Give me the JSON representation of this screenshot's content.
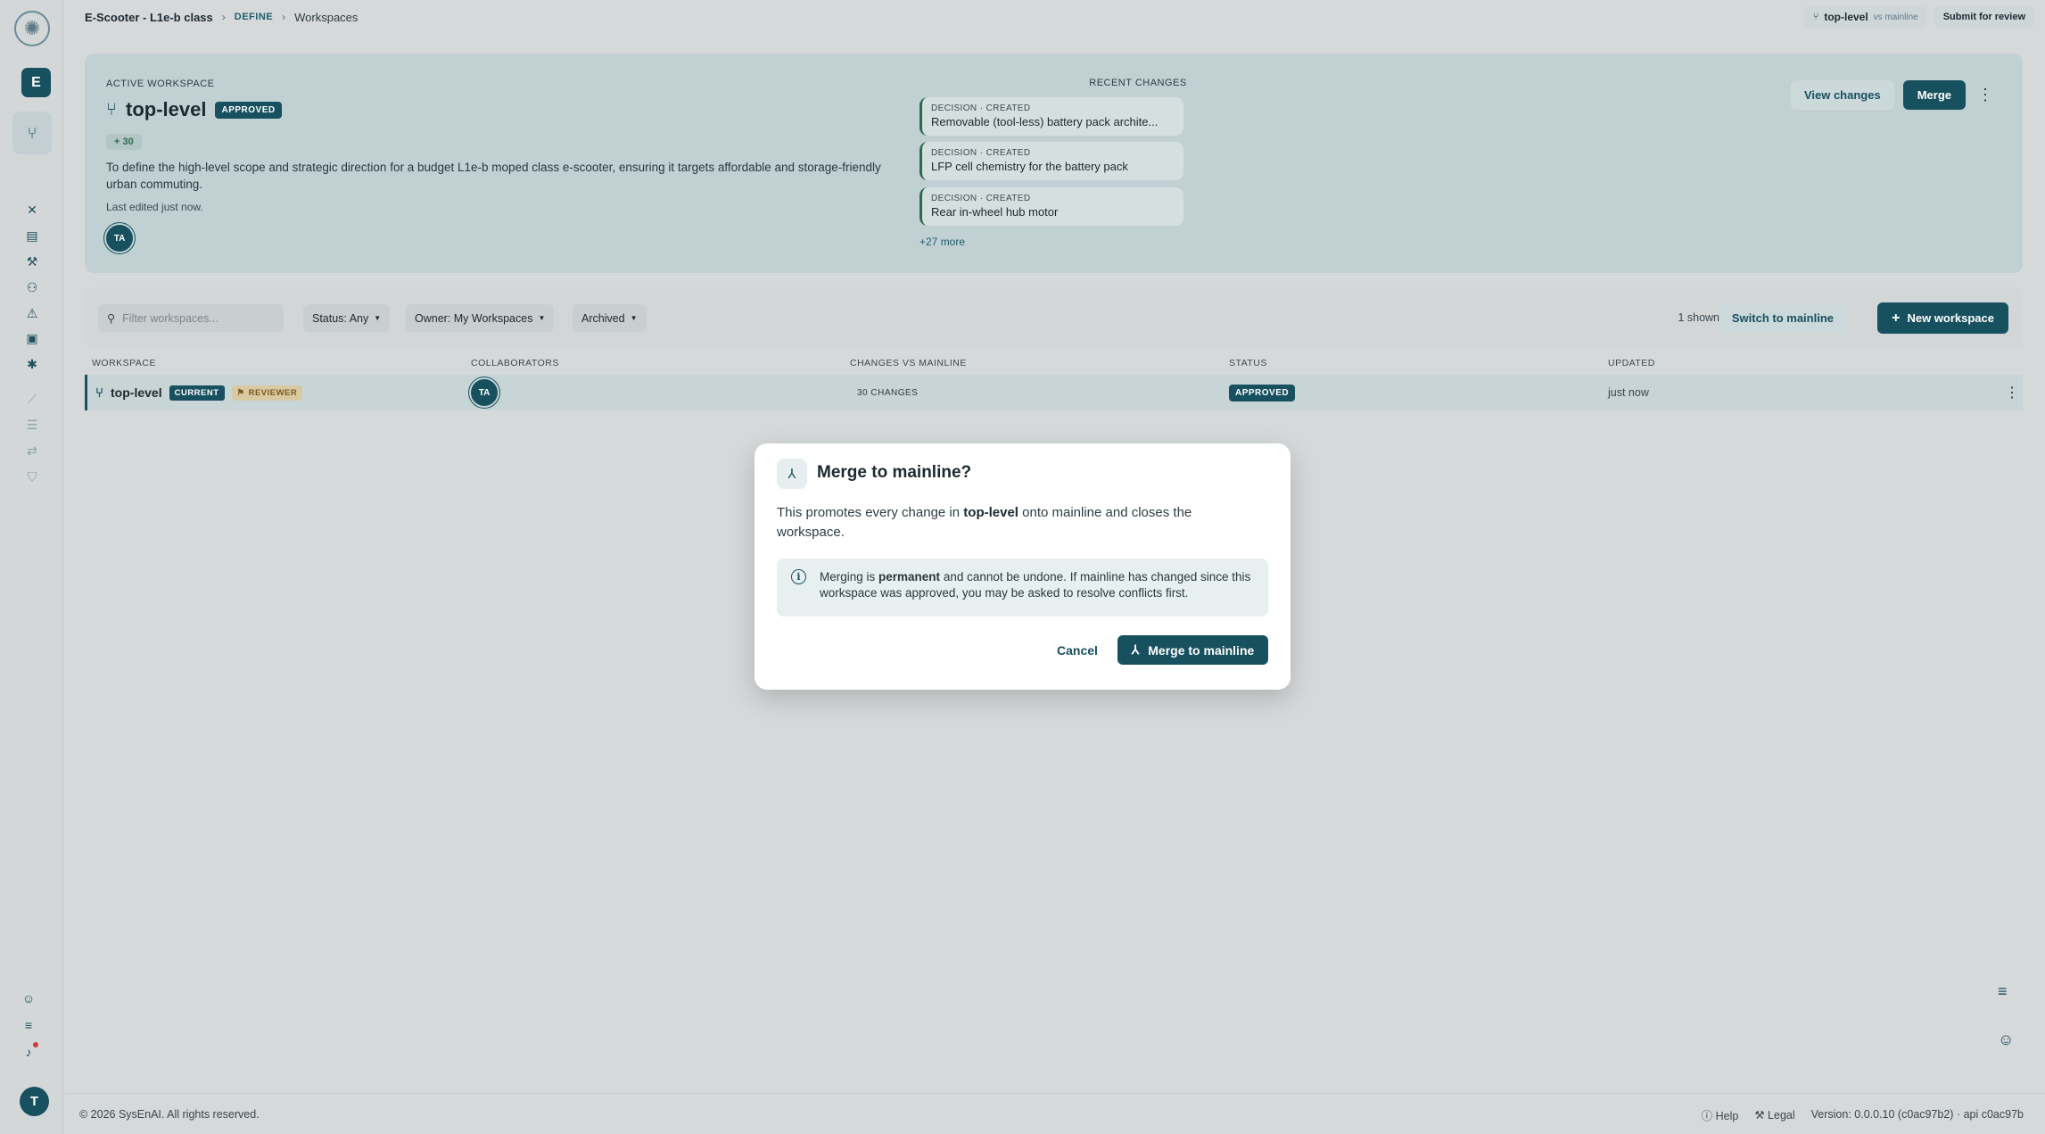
{
  "breadcrumb": {
    "project": "E-Scooter - L1e-b class",
    "section": "DEFINE",
    "page": "Workspaces"
  },
  "topbar": {
    "workspace": "top-level",
    "compare": "vs mainline",
    "submit_label": "Submit for review"
  },
  "sidebar": {
    "project_initial": "E",
    "user_initial": "T"
  },
  "active_workspace": {
    "label": "ACTIVE WORKSPACE",
    "name": "top-level",
    "status": "APPROVED",
    "changes_badge": "+ 30",
    "description": "To define the high-level scope and strategic direction for a budget L1e-b moped class e-scooter, ensuring it targets affordable and storage-friendly urban commuting.",
    "last_edited": "Last edited just now.",
    "avatar": "TA",
    "view_changes_label": "View changes",
    "merge_label": "Merge"
  },
  "recent_changes": {
    "label": "RECENT CHANGES",
    "items": [
      {
        "kind": "DECISION · CREATED",
        "title": "Removable (tool-less) battery pack archite..."
      },
      {
        "kind": "DECISION · CREATED",
        "title": "LFP cell chemistry for the battery pack"
      },
      {
        "kind": "DECISION · CREATED",
        "title": "Rear in-wheel hub motor"
      }
    ],
    "more": "+27 more"
  },
  "filters": {
    "search_placeholder": "Filter workspaces...",
    "status": "Status: Any",
    "owner": "Owner: My Workspaces",
    "archived": "Archived",
    "shown": "1 shown",
    "switch_label": "Switch to mainline",
    "new_label": "New workspace"
  },
  "table": {
    "headers": [
      "WORKSPACE",
      "COLLABORATORS",
      "CHANGES VS MAINLINE",
      "STATUS",
      "UPDATED"
    ],
    "rows": [
      {
        "name": "top-level",
        "current": "CURRENT",
        "role": "REVIEWER",
        "avatar": "TA",
        "changes": "30 CHANGES",
        "status": "APPROVED",
        "updated": "just now"
      }
    ]
  },
  "modal": {
    "title": "Merge to mainline?",
    "body_prefix": "This promotes every change in ",
    "body_workspace": "top-level",
    "body_suffix": " onto mainline and closes the workspace.",
    "info_prefix": "Merging is ",
    "info_bold": "permanent",
    "info_suffix": " and cannot be undone. If mainline has changed since this workspace was approved, you may be asked to resolve conflicts first.",
    "cancel_label": "Cancel",
    "confirm_label": "Merge to mainline"
  },
  "footer": {
    "copyright": "© 2026 SysEnAI. All rights reserved.",
    "help": "Help",
    "legal": "Legal",
    "version": "Version: 0.0.0.10 (c0ac97b2) · api c0ac97b"
  },
  "colors": {
    "brand": "#17505e",
    "background": "#d6d9da"
  }
}
